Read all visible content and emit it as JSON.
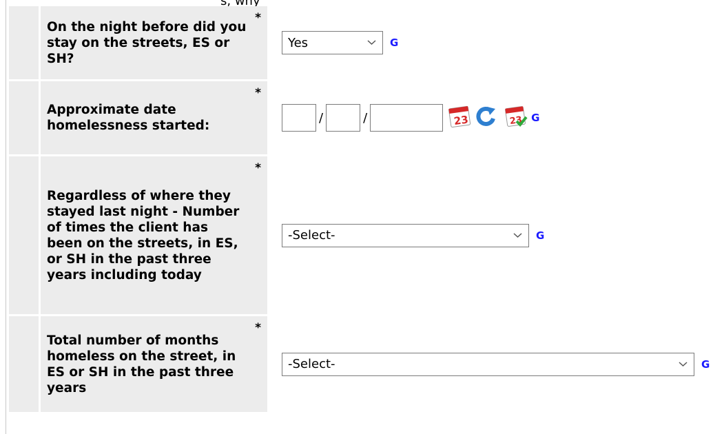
{
  "top_clip_text": "s, why",
  "rows": [
    {
      "label": "On the night before did you stay on the streets, ES or SH?",
      "required": "*",
      "select_value": "Yes",
      "guide": "G"
    },
    {
      "label": "Approximate date homelessness started:",
      "required": "*",
      "date": {
        "month": "",
        "day": "",
        "year": "",
        "separator": "/"
      },
      "icons": [
        "calendar-icon",
        "reset-icon",
        "calendar-today-icon"
      ],
      "guide": "G"
    },
    {
      "label": "Regardless of where they stayed last night - Number of times the client has been on the streets, in ES, or SH in the past three years including today",
      "required": "*",
      "select_value": "-Select-",
      "guide": "G"
    },
    {
      "label": "Total number of months homeless on the street, in ES or SH in the past three years",
      "required": "*",
      "select_value": "-Select-",
      "guide": "G"
    }
  ],
  "colors": {
    "label_bg": "#ececec",
    "guide_link": "#1a1aff",
    "calendar_red": "#d62828",
    "refresh_blue": "#2e7fd0",
    "check_green": "#2eaa3a"
  }
}
